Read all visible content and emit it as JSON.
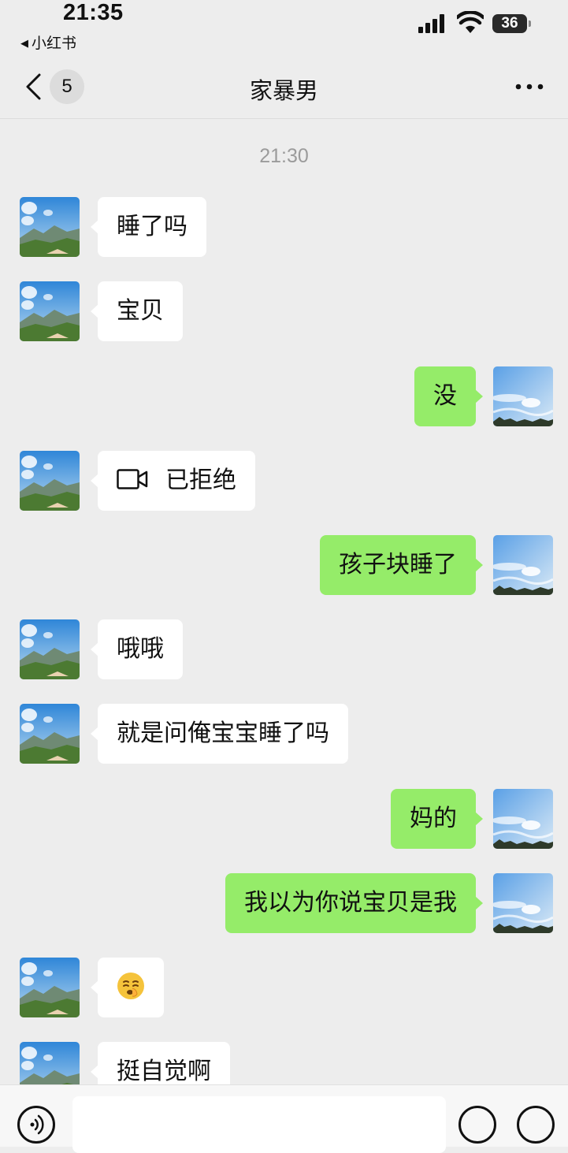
{
  "status_bar": {
    "time": "21:35",
    "back_app_label": "小红书",
    "battery_level": "36"
  },
  "nav": {
    "unread_count": "5",
    "title": "家暴男"
  },
  "chat": {
    "timestamp": "21:30",
    "messages": [
      {
        "side": "left",
        "text": "睡了吗"
      },
      {
        "side": "left",
        "text": "宝贝"
      },
      {
        "side": "right",
        "text": "没"
      },
      {
        "side": "left",
        "text": "已拒绝",
        "icon": "video-call-icon"
      },
      {
        "side": "right",
        "text": "孩子块睡了"
      },
      {
        "side": "left",
        "text": "哦哦"
      },
      {
        "side": "left",
        "text": "就是问俺宝宝睡了吗"
      },
      {
        "side": "right",
        "text": "妈的"
      },
      {
        "side": "right",
        "text": "我以为你说宝贝是我"
      },
      {
        "side": "left",
        "text": "",
        "icon": "shushing-face-emoji"
      },
      {
        "side": "left",
        "text": "挺自觉啊"
      }
    ]
  },
  "colors": {
    "background": "#ededed",
    "incoming_bubble": "#ffffff",
    "outgoing_bubble": "#95ec69"
  }
}
